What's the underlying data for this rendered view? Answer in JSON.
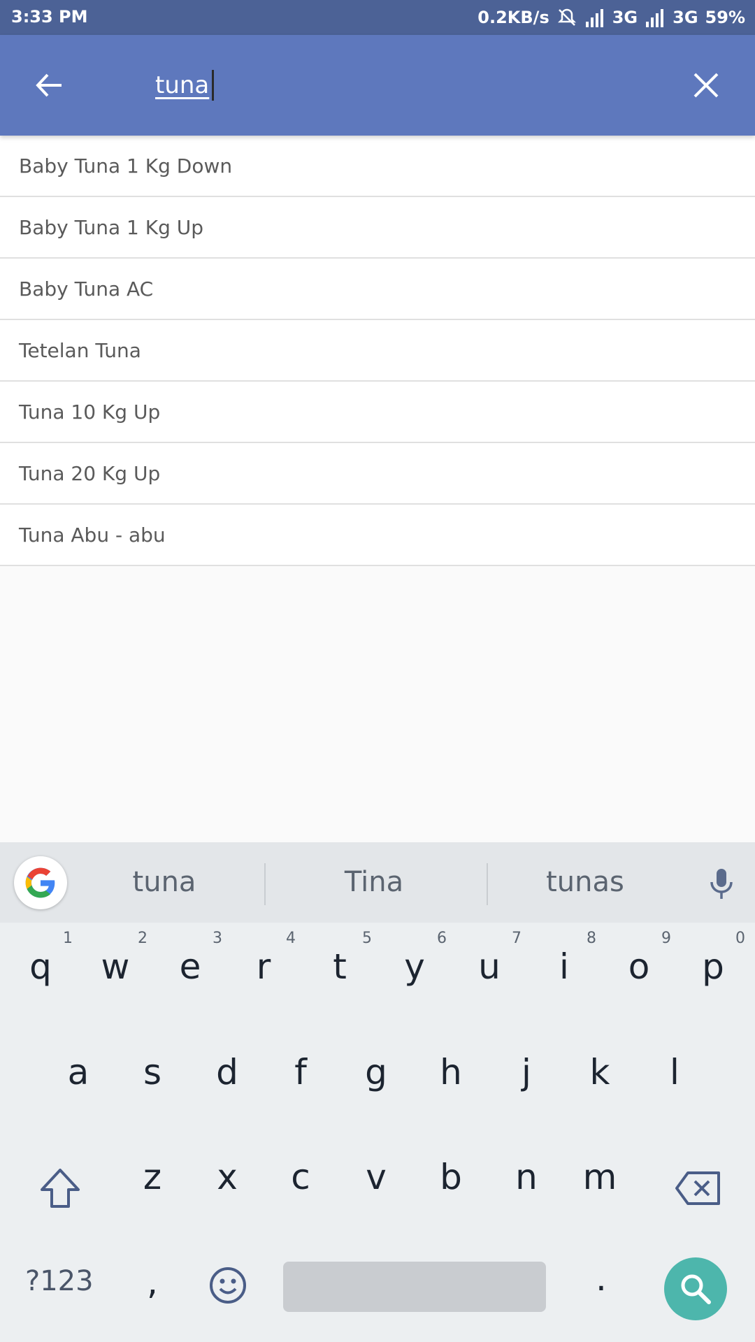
{
  "status_bar": {
    "time": "3:33 PM",
    "net_speed": "0.2KB/s",
    "network1": "3G",
    "network2": "3G",
    "battery": "59%"
  },
  "search": {
    "query": "tuna"
  },
  "results": [
    "Baby Tuna 1 Kg Down",
    "Baby Tuna 1 Kg Up",
    "Baby Tuna AC",
    "Tetelan Tuna",
    "Tuna 10 Kg Up",
    "Tuna 20 Kg Up",
    "Tuna Abu - abu"
  ],
  "keyboard": {
    "suggestions": [
      "tuna",
      "Tina",
      "tunas"
    ],
    "row1": [
      "q",
      "w",
      "e",
      "r",
      "t",
      "y",
      "u",
      "i",
      "o",
      "p"
    ],
    "row1_hints": [
      "1",
      "2",
      "3",
      "4",
      "5",
      "6",
      "7",
      "8",
      "9",
      "0"
    ],
    "row2": [
      "a",
      "s",
      "d",
      "f",
      "g",
      "h",
      "j",
      "k",
      "l"
    ],
    "row3": [
      "z",
      "x",
      "c",
      "v",
      "b",
      "n",
      "m"
    ],
    "symbols_label": "?123",
    "comma_label": ",",
    "period_label": "."
  },
  "colors": {
    "status_bar": "#4c6296",
    "app_bar": "#5e78bd",
    "search_key": "#4db6ac"
  }
}
